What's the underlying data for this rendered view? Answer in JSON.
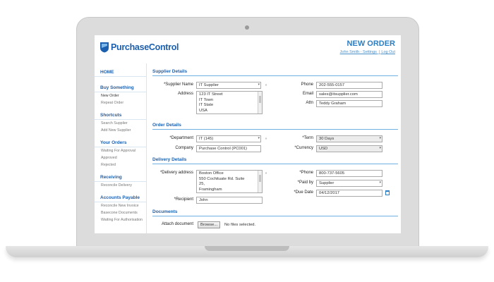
{
  "header": {
    "logo_text": "PurchaseControl",
    "page_title": "NEW ORDER",
    "user_link": "John Smith - Settings",
    "separator": "|",
    "logout_link": "Log Out"
  },
  "sidebar": {
    "home": "HOME",
    "groups": [
      {
        "title": "Buy Something",
        "items": [
          "New Order",
          "Repeat Order"
        ]
      },
      {
        "title": "Shortcuts",
        "items": [
          "Search Supplier",
          "Add New Supplier"
        ]
      },
      {
        "title": "Your Orders",
        "items": [
          "Waiting For Approval",
          "Approved",
          "Rejected"
        ]
      },
      {
        "title": "Receiving",
        "items": [
          "Reconcile Delivery"
        ]
      },
      {
        "title": "Accounts Payable",
        "items": [
          "Reconcile New Invoice",
          "Basecone Documents",
          "Waiting For Authorisation"
        ]
      }
    ]
  },
  "supplier_details": {
    "title": "Supplier Details",
    "supplier_name_label": "*Supplier Name",
    "supplier_name": "IT Supplier",
    "address_label": "Address",
    "address_lines": [
      "123 IT Street",
      "IT Town",
      "IT State",
      "USA"
    ],
    "phone_label": "Phone",
    "phone": "202-555-0157",
    "email_label": "Email",
    "email": "sales@itsupplier.com",
    "attn_label": "Attn",
    "attn": "Teddy Graham"
  },
  "order_details": {
    "title": "Order Details",
    "department_label": "*Department",
    "department": "IT (145)",
    "company_label": "Company",
    "company": "Purchase Control (PC001)",
    "term_label": "*Term",
    "term": "30 Days",
    "currency_label": "*Currency",
    "currency": "USD"
  },
  "delivery_details": {
    "title": "Delivery Details",
    "delivery_address_label": "*Delivery address",
    "delivery_address_lines": [
      "Boston Office",
      "550 Cochituate Rd. Suite",
      "25,",
      "Framingham"
    ],
    "recipient_label": "*Recipient",
    "recipient": "John",
    "phone_label": "*Phone",
    "phone": "800-737-5605",
    "paid_by_label": "*Paid by",
    "paid_by": "Supplier",
    "due_date_label": "*Due Date",
    "due_date": "04/12/2017"
  },
  "documents": {
    "title": "Documents",
    "attach_label": "Attach document",
    "browse_label": "Browse...",
    "no_files": "No files selected."
  },
  "icons": {
    "logo": "shield-logo-icon",
    "calendar": "calendar-icon",
    "dropdown": "chevron-down-icon"
  },
  "colors": {
    "brand_blue": "#1c5fae",
    "accent_blue": "#2a7ec4",
    "section_rule": "#6fb0e0"
  }
}
